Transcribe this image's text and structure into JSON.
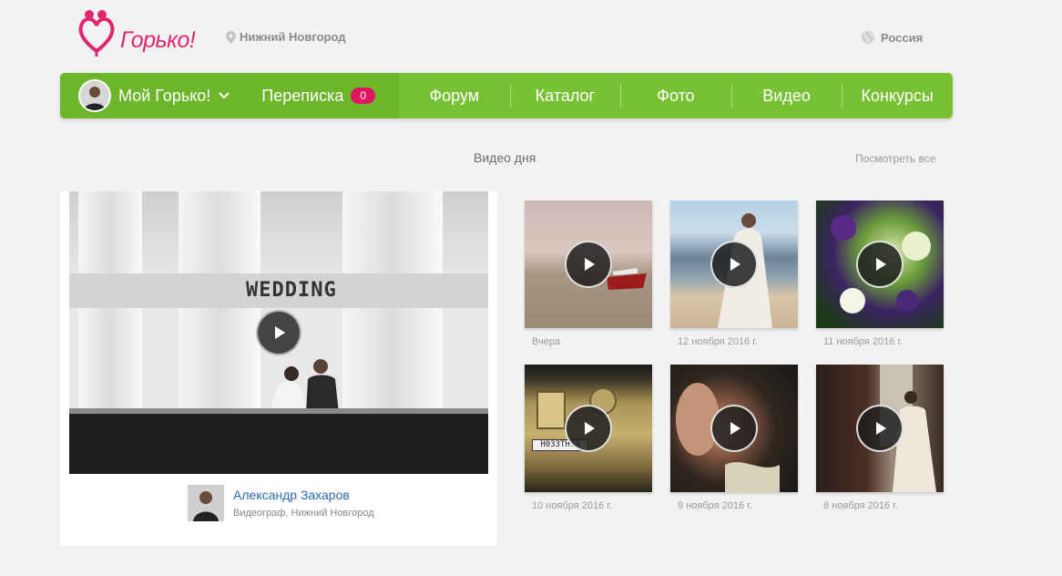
{
  "header": {
    "logo_text": "Горько!",
    "city": "Нижний Новгород",
    "country": "Россия"
  },
  "nav": {
    "my_label": "Мой Горько!",
    "messages_label": "Переписка",
    "messages_count": "0",
    "items": [
      {
        "label": "Форум"
      },
      {
        "label": "Каталог"
      },
      {
        "label": "Фото"
      },
      {
        "label": "Видео"
      },
      {
        "label": "Конкурсы"
      }
    ]
  },
  "section": {
    "title": "Видео дня",
    "see_all": "Посмотреть все"
  },
  "featured": {
    "overlay_text": "WEDDING",
    "author_name": "Александр Захаров",
    "author_role": "Видеограф, Нижний Новгород"
  },
  "videos": [
    {
      "date": "Вчера"
    },
    {
      "date": "12 ноября 2016 г."
    },
    {
      "date": "11 ноября 2016 г."
    },
    {
      "date": "10 ноября 2016 г.",
      "plate": "Н033ТН74"
    },
    {
      "date": "9 ноября 2016 г."
    },
    {
      "date": "8 ноября 2016 г."
    }
  ],
  "colors": {
    "brand_pink": "#e0266f",
    "nav_green": "#78c135",
    "badge": "#e0145f",
    "link_blue": "#2a6bb5"
  }
}
